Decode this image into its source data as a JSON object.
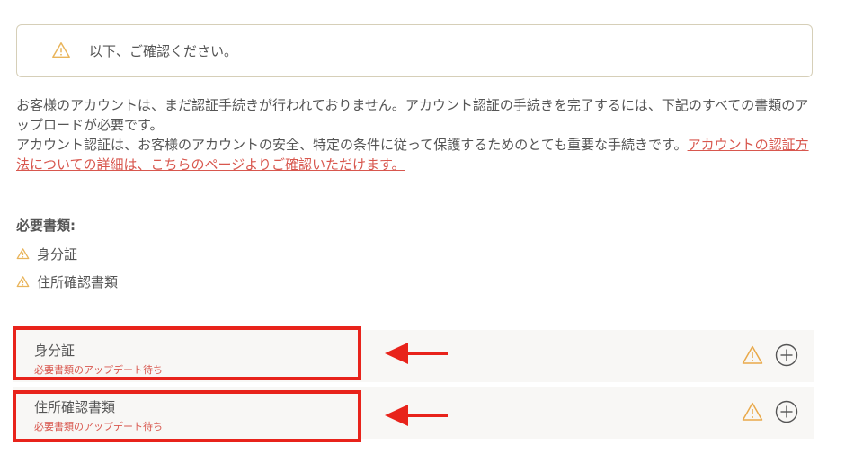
{
  "notice": {
    "icon": "warning-icon",
    "text": "以下、ご確認ください。"
  },
  "description": {
    "line1": "お客様のアカウントは、まだ認証手続きが行われておりません。アカウント認証の手続きを完了するには、下記のすべての書類のアップロードが必要です。",
    "line2": "アカウント認証は、お客様のアカウントの安全、特定の条件に従って保護するためのとても重要な手続きです。",
    "link": "アカウントの認証方法についての詳細は、こちらのページよりご確認いただけます。"
  },
  "required": {
    "title": "必要書類:",
    "items": [
      "身分証",
      "住所確認書類"
    ]
  },
  "documents": [
    {
      "title": "身分証",
      "status": "必要書類のアップデート待ち"
    },
    {
      "title": "住所確認書類",
      "status": "必要書類のアップデート待ち"
    }
  ],
  "colors": {
    "accent": "#d8574e",
    "warning": "#e9a94a",
    "highlight": "#e8231b"
  }
}
